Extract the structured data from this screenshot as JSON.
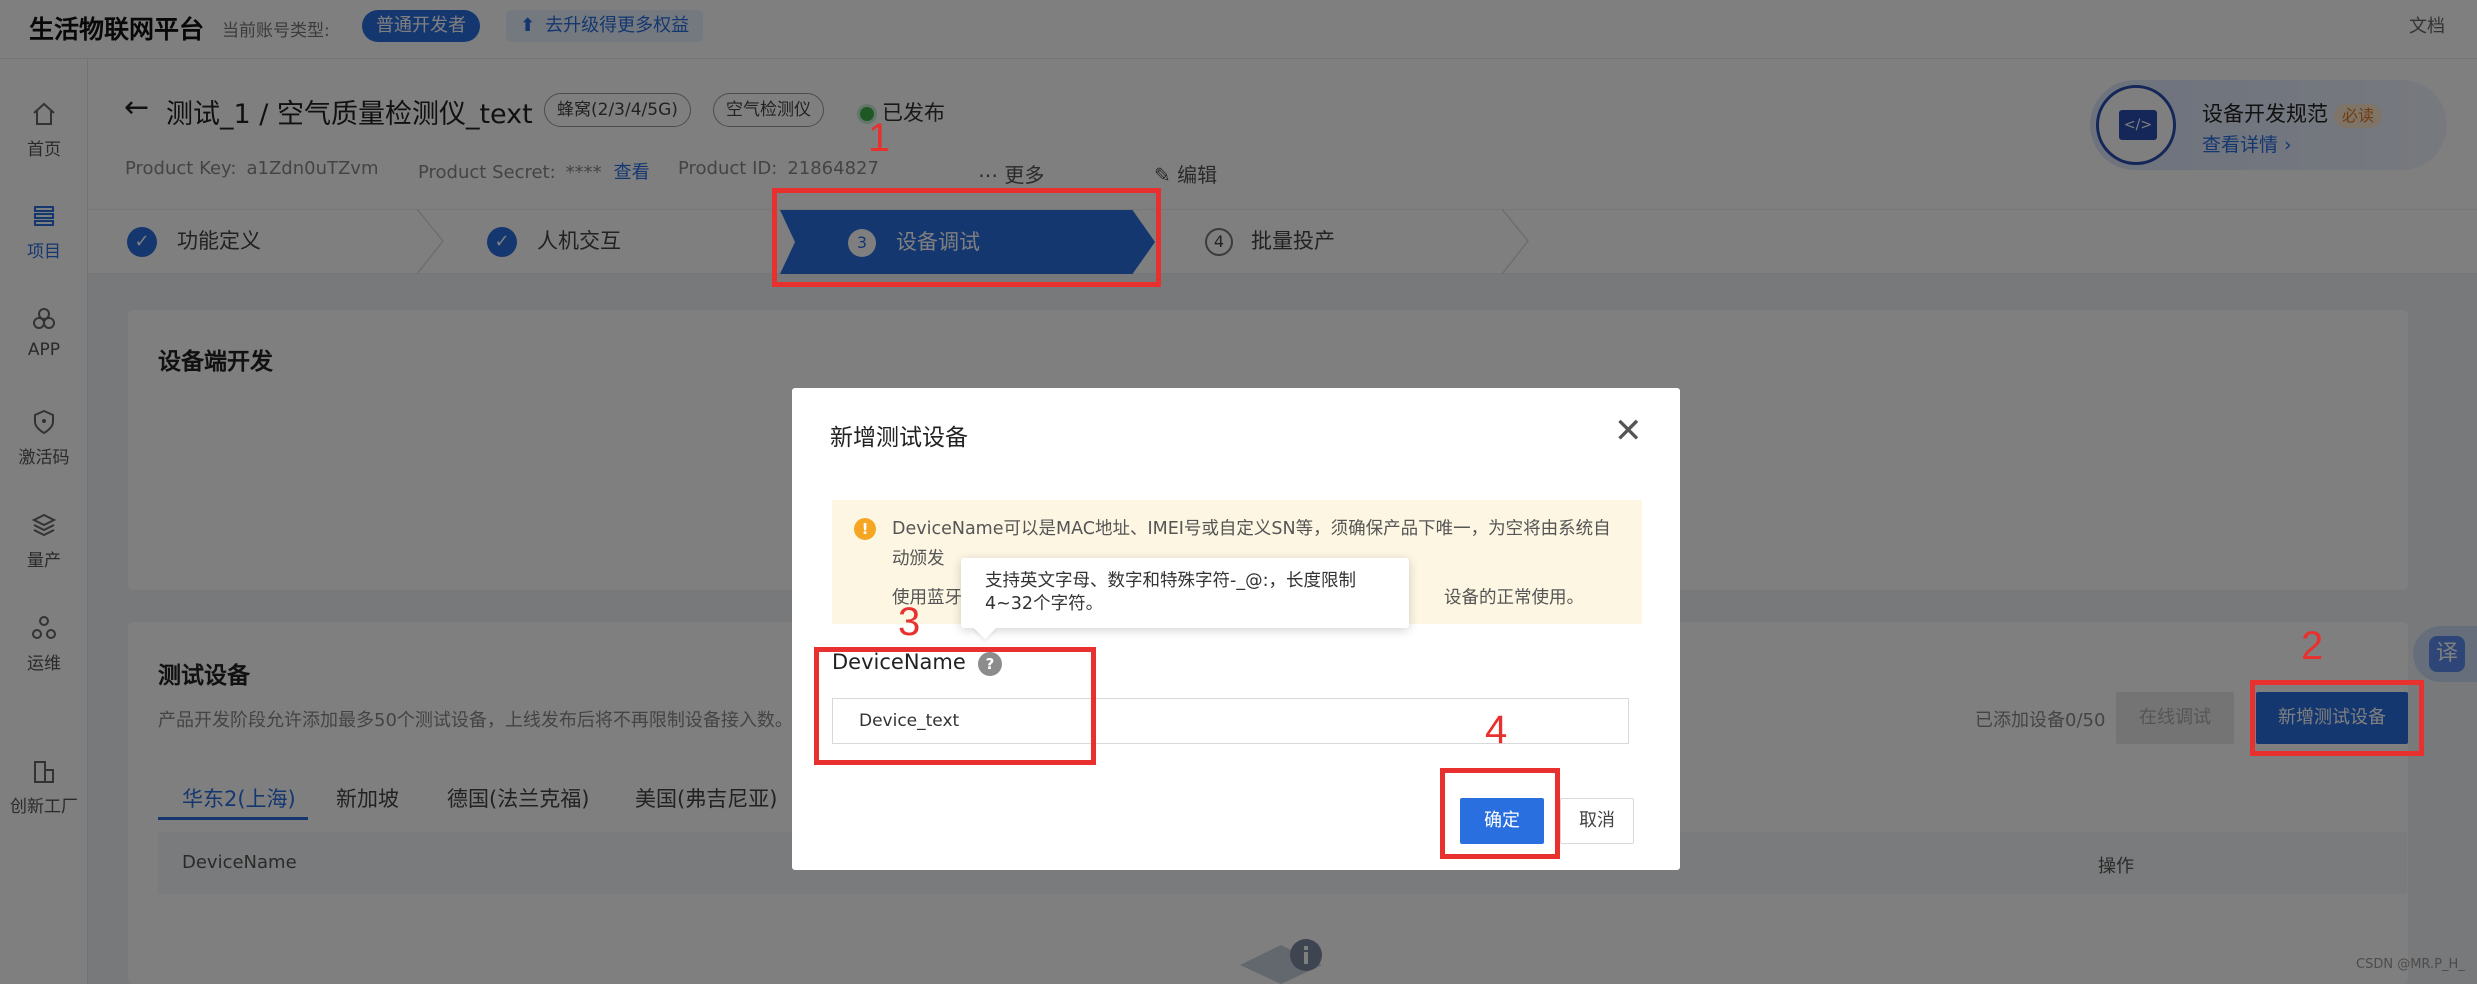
{
  "topbar": {
    "brand": "生活物联网平台",
    "account_label": "当前账号类型:",
    "account_badge": "普通开发者",
    "upgrade_arrow": "⬆",
    "upgrade": "去升级得更多权益",
    "docs": "文档"
  },
  "sidebar": {
    "items": [
      {
        "label": "首页",
        "icon": "home-icon"
      },
      {
        "label": "项目",
        "icon": "list-icon"
      },
      {
        "label": "APP",
        "icon": "app-icon"
      },
      {
        "label": "激活码",
        "icon": "shield-icon"
      },
      {
        "label": "量产",
        "icon": "layers-icon"
      },
      {
        "label": "运维",
        "icon": "ops-icon"
      },
      {
        "label": "创新工厂",
        "icon": "factory-icon"
      }
    ]
  },
  "header": {
    "back": "←",
    "title": "测试_1 / 空气质量检测仪_text",
    "tags": [
      "蜂窝(2/3/4/5G)",
      "空气检测仪"
    ],
    "status": "已发布",
    "product_key_label": "Product Key:",
    "product_key": "a1Zdn0uTZvm",
    "product_secret_label": "Product Secret:",
    "product_secret": "****",
    "view_link": "查看",
    "product_id_label": "Product ID:",
    "product_id": "21864827",
    "more": "⋯ 更多",
    "edit": "✎ 编辑"
  },
  "spec_card": {
    "icon_text": "</>",
    "title": "设备开发规范",
    "badge": "必读",
    "link": "查看详情 ›"
  },
  "steps": [
    {
      "label": "功能定义",
      "marker": "✓"
    },
    {
      "label": "人机交互",
      "marker": "✓"
    },
    {
      "label": "设备调试",
      "marker": "3"
    },
    {
      "label": "批量投产",
      "marker": "4"
    }
  ],
  "device_dev": {
    "title": "设备端开发"
  },
  "test_devices": {
    "title": "测试设备",
    "desc": "产品开发阶段允许添加最多50个测试设备，上线发布后将不再限制设备接入数。",
    "count": "已添加设备0/50",
    "online_btn": "在线调试",
    "new_btn": "新增测试设备",
    "regions": [
      "华东2(上海)",
      "新加坡",
      "德国(法兰克福)",
      "美国(弗吉尼亚)"
    ],
    "columns": [
      "DeviceName",
      "操作"
    ]
  },
  "translate": "译",
  "watermark": "CSDN @MR.P_H_",
  "modal": {
    "title": "新增测试设备",
    "close": "✕",
    "alert_icon": "!",
    "alert_line1": "DeviceName可以是MAC地址、IMEI号或自定义SN等，须确保产品下唯一，为空将由系统自动颁发",
    "alert_line2": "使用蓝牙",
    "alert_line3": "设备的正常使用。",
    "tooltip": "支持英文字母、数字和特殊字符-_@:，长度限制4~32个字符。",
    "field_label": "DeviceName",
    "help_icon": "?",
    "field_value": "Device_text",
    "ok": "确定",
    "cancel": "取消"
  },
  "annotations": {
    "labels": [
      "1",
      "2",
      "3",
      "4"
    ],
    "color": "#e8312f"
  },
  "colors": {
    "accent": "#2a6fe0",
    "annotation": "#e8312f"
  }
}
